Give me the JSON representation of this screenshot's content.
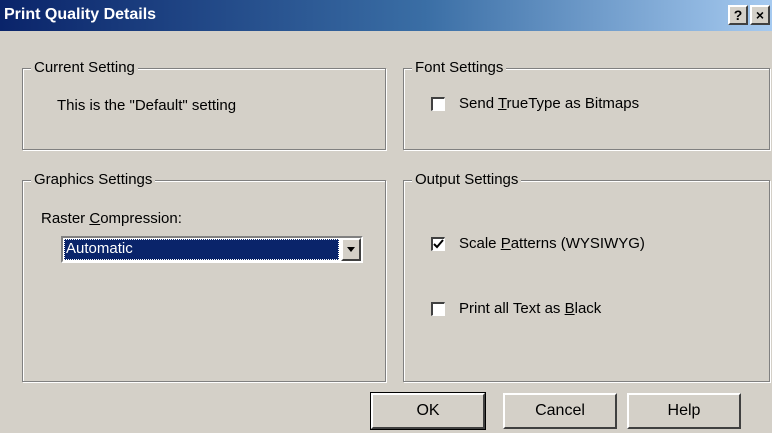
{
  "window": {
    "title": "Print Quality Details",
    "help_button": "?",
    "close_button": "×"
  },
  "current_setting": {
    "legend": "Current Setting",
    "text": "This is the \"Default\" setting"
  },
  "font_settings": {
    "legend": "Font Settings",
    "send_truetype": {
      "label_before": "Send ",
      "label_mnemonic": "T",
      "label_after": "rueType as Bitmaps",
      "checked": false
    }
  },
  "graphics_settings": {
    "legend": "Graphics Settings",
    "raster_label_before": "Raster ",
    "raster_label_mnemonic": "C",
    "raster_label_after": "ompression:",
    "raster_value": "Automatic"
  },
  "output_settings": {
    "legend": "Output Settings",
    "scale_patterns": {
      "label_before": "Scale ",
      "label_mnemonic": "P",
      "label_after": "atterns (WYSIWYG)",
      "checked": true
    },
    "print_black": {
      "label_before": "Print all Text as ",
      "label_mnemonic": "B",
      "label_after": "lack",
      "checked": false
    }
  },
  "buttons": {
    "ok": "OK",
    "cancel": "Cancel",
    "help": "Help"
  }
}
